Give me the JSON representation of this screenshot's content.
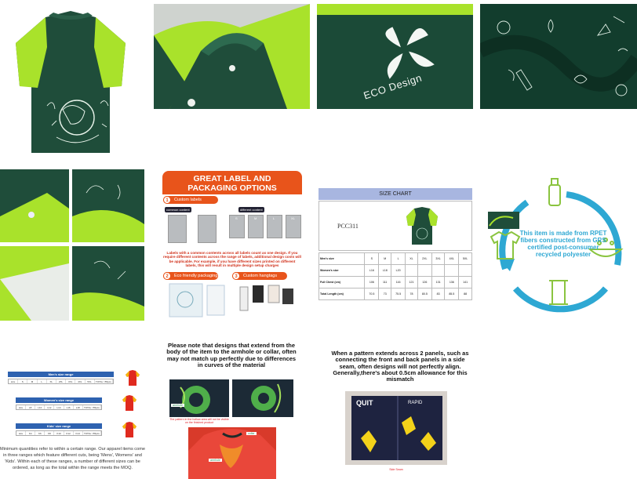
{
  "eco_logo": {
    "text": "ECO Design"
  },
  "label_panel": {
    "title_line1": "GREAT LABEL AND",
    "title_line2": "PACKAGING OPTIONS",
    "sections": [
      {
        "num": "1",
        "label": "Custom labels"
      },
      {
        "num": "2",
        "label": "Eco friendly packaging"
      },
      {
        "num": "3",
        "label": "Custom hangtags"
      }
    ],
    "captions": {
      "common": "common content",
      "different": "different content"
    },
    "tag_sizes": [
      "S",
      "M",
      "L",
      "XL"
    ],
    "warning": "Labels with a common contents across all labels count as one design. If you require different contents across the range of labels, additional design costs will be applicable. For example, if you have different sizes printed on different labels, this will result in multiple design setup charges"
  },
  "size_chart": {
    "title": "SIZE CHART",
    "code": "PCC311",
    "rows": [
      {
        "label": "Men's size",
        "values": [
          "S",
          "M",
          "L",
          "XL",
          "2XL",
          "3XL",
          "4XL",
          "5XL"
        ]
      },
      {
        "label": "Women's size",
        "values": [
          "L16",
          "L18",
          "L20",
          "",
          "",
          "",
          "",
          ""
        ]
      },
      {
        "label": "Full Chest (cm)",
        "values": [
          "106",
          "111",
          "116",
          "121",
          "126",
          "131",
          "136",
          "141"
        ]
      },
      {
        "label": "Total Length (cm)",
        "values": [
          "70.5",
          "73",
          "75.5",
          "78",
          "80.5",
          "83",
          "85.5",
          "88"
        ]
      }
    ]
  },
  "eco_panel": {
    "text": "This item is made from RPET fibers constructed from GRS certified post-consumer recycled polyester"
  },
  "range_panel": {
    "men_title": "Men's size range",
    "women_title": "Women's size range",
    "kids_title": "Kids' size range",
    "men_sizes": [
      "size",
      "S",
      "M",
      "L",
      "XL",
      "2XL",
      "3XL",
      "4XL",
      "5XL",
      "TOTAL >55pcs"
    ],
    "women_sizes": [
      "size",
      "L8",
      "L10",
      "L12",
      "L14",
      "L16",
      "L18",
      "TOTAL >55pcs"
    ],
    "kids_sizes": [
      "size",
      "K4",
      "K6",
      "K8",
      "K10",
      "K12",
      "K14",
      "TOTAL >55pcs"
    ],
    "note": "Minimum quantities refer to within a certain range. Our apparel items come in three ranges which feature different cuts, being 'Mens', Womens' and 'Kids'. Within each of these ranges, a number of different sizes can be ordered, as long as the total within the range meets the MOQ."
  },
  "note1": {
    "title": "Please note that designs that extend from the body of the item to the armhole or collar, often may not match up perfectly due to differences in curves of the material",
    "caption": "The pattern in the hollow area will not be visible on the finished product",
    "tag_armhole": "armhole",
    "tag_collar": "collar"
  },
  "note2": {
    "title": "When a pattern extends across 2 panels, such as connecting the front and back panels in a side seam, often designs will not perfectly align. Generally,there's about 0.5cm allowance for this mismatch",
    "caption": "Side Seam",
    "shirt_word1": "QUIT",
    "shirt_word2": "RAPID"
  },
  "colors": {
    "lime": "#a9e22b",
    "forest": "#1f4d3a",
    "orange": "#e8541b",
    "blue": "#2e62b0",
    "cyan": "#2ea8d3"
  }
}
